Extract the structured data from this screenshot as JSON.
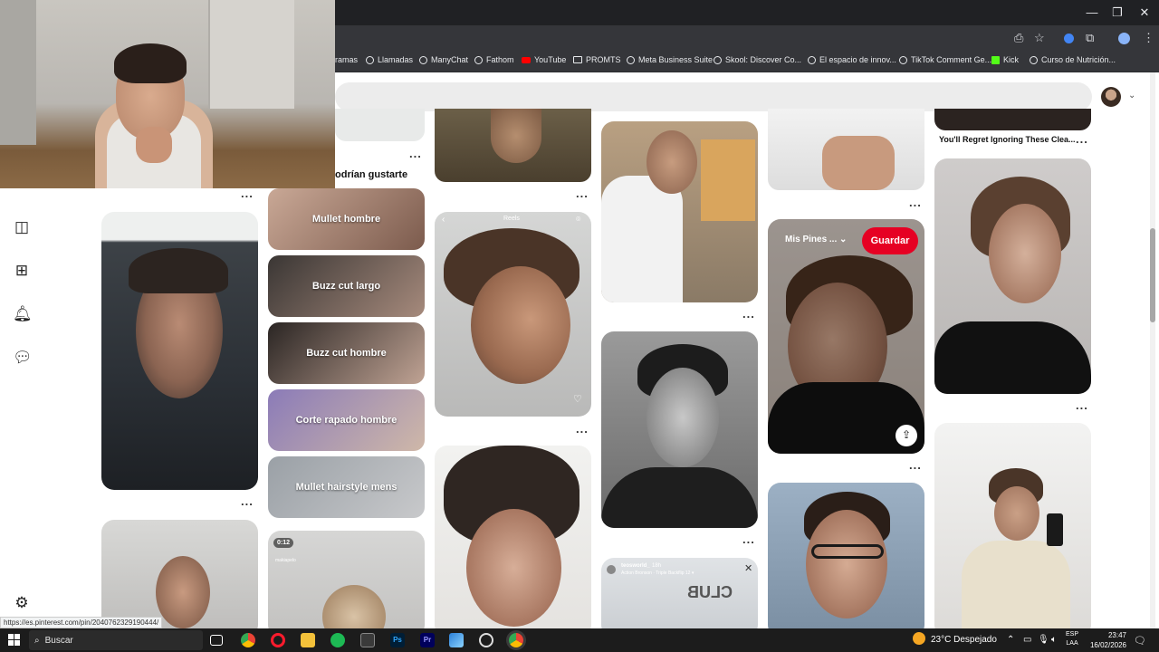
{
  "browser": {
    "window_controls": [
      "—",
      "❐",
      "✕"
    ],
    "bookmarks": [
      {
        "label": "ramas",
        "icon": "none"
      },
      {
        "label": "Llamadas",
        "icon": "globe-icon"
      },
      {
        "label": "ManyChat",
        "icon": "globe-icon"
      },
      {
        "label": "Fathom",
        "icon": "globe-icon"
      },
      {
        "label": "YouTube",
        "icon": "youtube-icon"
      },
      {
        "label": "PROMTS",
        "icon": "folder-icon"
      },
      {
        "label": "Meta Business Suite",
        "icon": "globe-icon"
      },
      {
        "label": "Skool: Discover Co...",
        "icon": "globe-icon"
      },
      {
        "label": "El espacio de innov...",
        "icon": "globe-icon"
      },
      {
        "label": "TikTok Comment Ge...",
        "icon": "globe-icon"
      },
      {
        "label": "Kick",
        "icon": "kick-icon"
      },
      {
        "label": "Curso de Nutrición...",
        "icon": "globe-icon"
      }
    ],
    "status_url": "https://es.pinterest.com/pin/2040762329190444/"
  },
  "pinterest": {
    "section_header": "odrían gustarte",
    "categories": [
      "Mullet hombre",
      "Buzz cut largo",
      "Buzz cut hombre",
      "Corte rapado hombre",
      "Mullet hairstyle mens"
    ],
    "hover_pin": {
      "board_label": "Mis Pines ...",
      "save_label": "Guardar"
    },
    "pin_title": "You'll Regret Ignoring These Clea...",
    "video_badge": "0:12",
    "video_author": "makiapelo",
    "reels_label": "Reels",
    "story_author": "teosworld_",
    "story_time": "18h",
    "story_subtitle": "Action Bronson · Triple Backflip 12 ▾",
    "club_text": "CLUB",
    "more_label": "..."
  },
  "taskbar": {
    "search_placeholder": "Buscar",
    "weather": "23°C  Despejado",
    "lang_top": "ESP",
    "lang_bottom": "LAA",
    "time": "23:47",
    "date": "16/02/2026"
  }
}
